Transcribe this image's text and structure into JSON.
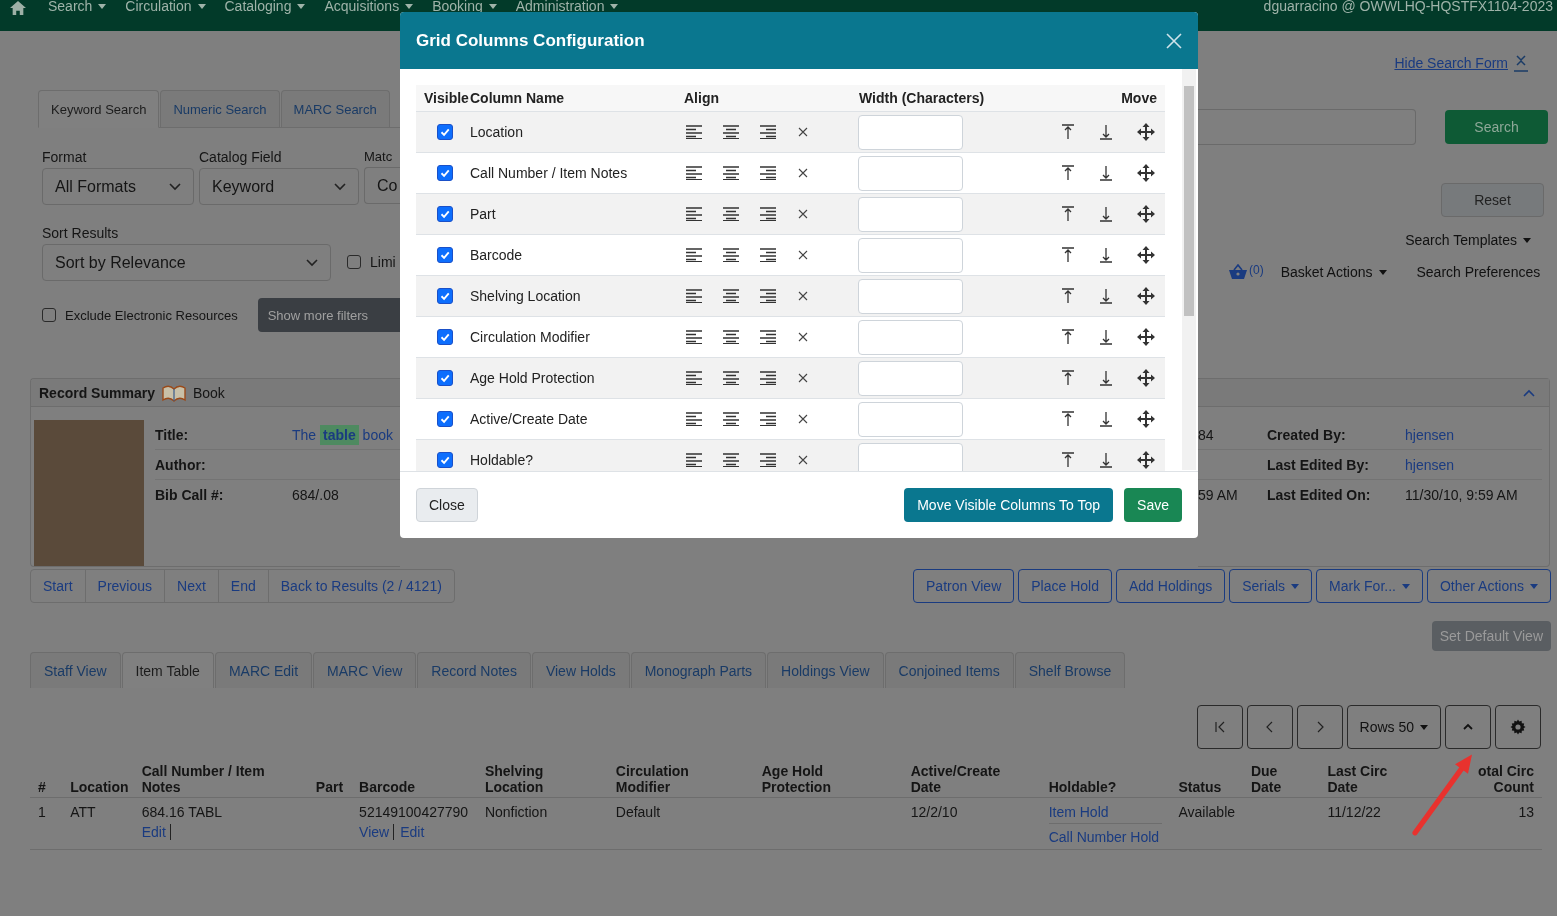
{
  "nav": {
    "items": [
      {
        "label": "Search"
      },
      {
        "label": "Circulation"
      },
      {
        "label": "Cataloging"
      },
      {
        "label": "Acquisitions"
      },
      {
        "label": "Booking"
      },
      {
        "label": "Administration"
      }
    ],
    "user": "dguarracino @ OWWLHQ-HQSTFX1104-2023"
  },
  "search_form": {
    "hide_link": "Hide Search Form",
    "tabs": [
      {
        "label": "Keyword Search",
        "selected": true
      },
      {
        "label": "Numeric Search",
        "selected": false
      },
      {
        "label": "MARC Search",
        "selected": false
      }
    ],
    "fields": [
      {
        "label": "Format",
        "value": "All Formats"
      },
      {
        "label": "Catalog Field",
        "value": "Keyword"
      },
      {
        "label": "Matc",
        "value": "Co"
      }
    ],
    "sort": {
      "label": "Sort Results",
      "value": "Sort by Relevance"
    },
    "limit": {
      "label": "Limi",
      "checked": false
    },
    "exclude": {
      "label": "Exclude Electronic Resources",
      "checked": false
    },
    "more_filters": "Show more filters",
    "search_button": "Search",
    "reset_button": "Reset",
    "templates": "Search Templates",
    "basket_count": "(0)",
    "basket_actions": "Basket Actions",
    "preferences": "Search Preferences"
  },
  "record_summary": {
    "title": "Record Summary",
    "format": "Book",
    "left_rows": [
      {
        "label": "Title:",
        "value": "The **table** book"
      },
      {
        "label": "Author:"
      },
      {
        "label": "Bib Call #:",
        "value": "684/.08"
      }
    ],
    "right_rows": [
      {
        "fragment": "84",
        "label": "Created By:",
        "value": "hjensen",
        "link": true
      },
      {
        "label": "Last Edited By:",
        "value": "hjensen",
        "link": true
      },
      {
        "fragment": "59 AM",
        "label": "Last Edited On:",
        "value": "11/30/10, 9:59 AM",
        "link": false
      }
    ],
    "nav_links": [
      "Start",
      "Previous",
      "Next",
      "End",
      "Back to Results (2 / 4121)"
    ],
    "actions": [
      {
        "label": "Patron View",
        "dropdown": false
      },
      {
        "label": "Place Hold",
        "dropdown": false
      },
      {
        "label": "Add Holdings",
        "dropdown": false
      },
      {
        "label": "Serials",
        "dropdown": true
      },
      {
        "label": "Mark For...",
        "dropdown": true
      },
      {
        "label": "Other Actions",
        "dropdown": true
      }
    ]
  },
  "set_default": "Set Default View",
  "record_tabs": [
    {
      "label": "Staff View",
      "selected": false
    },
    {
      "label": "Item Table",
      "selected": true
    },
    {
      "label": "MARC Edit",
      "selected": false
    },
    {
      "label": "MARC View",
      "selected": false
    },
    {
      "label": "Record Notes",
      "selected": false
    },
    {
      "label": "View Holds",
      "selected": false
    },
    {
      "label": "Monograph Parts",
      "selected": false
    },
    {
      "label": "Holdings View",
      "selected": false
    },
    {
      "label": "Conjoined Items",
      "selected": false
    },
    {
      "label": "Shelf Browse",
      "selected": false
    }
  ],
  "grid": {
    "rows_button": "Rows 50",
    "columns": [
      {
        "label": "#"
      },
      {
        "label": "Location"
      },
      {
        "label": "Call Number / Item Notes"
      },
      {
        "label": "Part"
      },
      {
        "label": "Barcode"
      },
      {
        "label": "Shelving Location"
      },
      {
        "label": "Circulation Modifier"
      },
      {
        "label": "Age Hold Protection"
      },
      {
        "label": "Active/Create Date"
      },
      {
        "label": "Holdable?"
      },
      {
        "label": "Status"
      },
      {
        "label": "Due Date"
      },
      {
        "label": "Last Circ Date"
      },
      {
        "label": "otal Circ Count"
      }
    ],
    "rows": [
      {
        "cells": [
          {
            "text": "1"
          },
          {
            "text": "ATT"
          },
          {
            "text": "684.16 TABL",
            "links": [
              "Edit"
            ]
          },
          {},
          {
            "text": "52149100427790",
            "links": [
              "View",
              "Edit"
            ]
          },
          {
            "text": "Nonfiction"
          },
          {
            "text": "Default"
          },
          {},
          {
            "text": "12/2/10"
          },
          {
            "links": [
              "Item Hold",
              "Call Number Hold"
            ]
          },
          {
            "text": "Available"
          },
          {},
          {
            "text": "11/12/22"
          },
          {
            "text": "13"
          }
        ]
      }
    ]
  },
  "modal": {
    "title": "Grid Columns Configuration",
    "headers": [
      "Visible",
      "Column Name",
      "Align",
      "Width (Characters)",
      "Move"
    ],
    "rows": [
      {
        "name": "Location",
        "visible": true
      },
      {
        "name": "Call Number / Item Notes",
        "visible": true
      },
      {
        "name": "Part",
        "visible": true
      },
      {
        "name": "Barcode",
        "visible": true
      },
      {
        "name": "Shelving Location",
        "visible": true
      },
      {
        "name": "Circulation Modifier",
        "visible": true
      },
      {
        "name": "Age Hold Protection",
        "visible": true
      },
      {
        "name": "Active/Create Date",
        "visible": true
      },
      {
        "name": "Holdable?",
        "visible": true
      }
    ],
    "close": "Close",
    "move_top": "Move Visible Columns To Top",
    "save": "Save"
  }
}
